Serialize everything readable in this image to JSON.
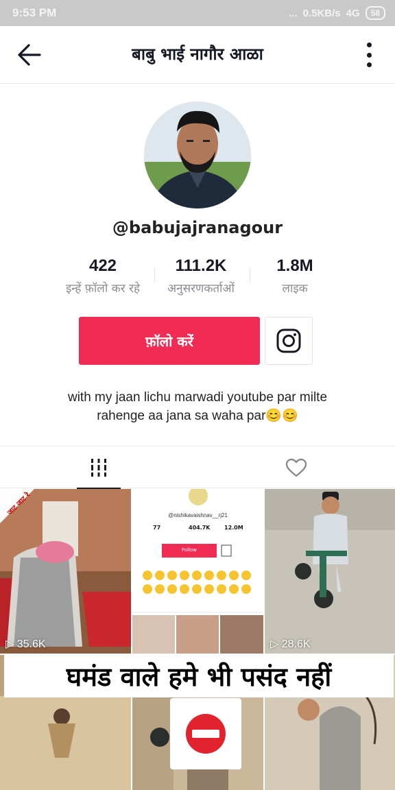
{
  "status_bar": {
    "time": "9:53 PM",
    "dots": "...",
    "network": "0.5KB/s",
    "signal": "4G",
    "battery": "58"
  },
  "header": {
    "title": "बाबु भाई नागौर आळा"
  },
  "profile": {
    "username": "@babujajranagour",
    "stats": [
      {
        "value": "422",
        "label": "इन्हें फ़ॉलो कर रहे"
      },
      {
        "value": "111.2K",
        "label": "अनुसरणकर्ताओं"
      },
      {
        "value": "1.8M",
        "label": "लाइक"
      }
    ],
    "follow_label": "फ़ॉलो करें",
    "bio_line1": "with my jaan lichu marwadi youtube par milte",
    "bio_line2": "rahenge aa jana sa waha par😊😊"
  },
  "videos": [
    {
      "views": "35.6K",
      "badge": "जाट जाट रे"
    },
    {
      "views": "",
      "mini_handle": "@nishikavaishnav__rj21",
      "mini_stats": [
        "77",
        "404.7K",
        "12.0M"
      ],
      "mini_follow": "Follow"
    },
    {
      "views": "28.6K"
    }
  ],
  "overlay": {
    "caption": "घमंड वाले हमे भी पसंद नहीं"
  },
  "colors": {
    "accent": "#f02c55",
    "text": "#161823",
    "secondary": "#8a8b91"
  }
}
